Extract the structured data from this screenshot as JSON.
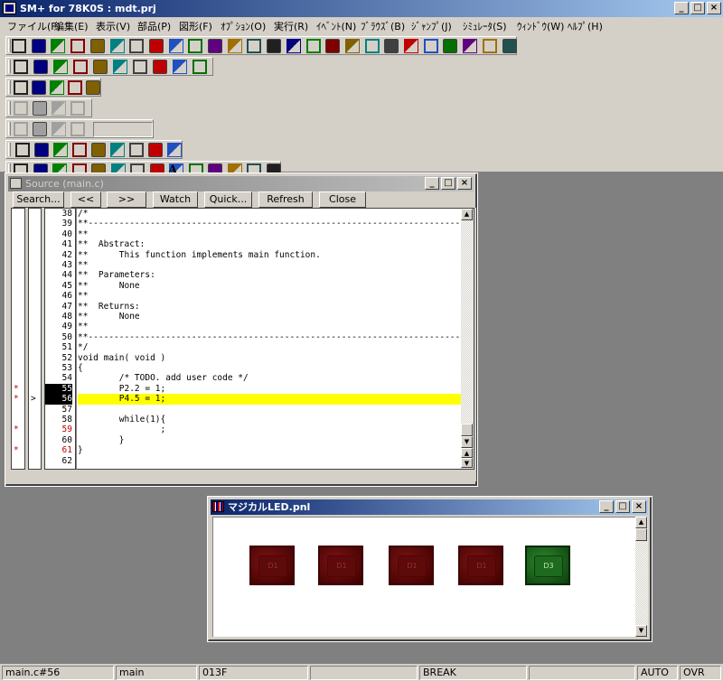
{
  "app": {
    "title": "SM+ for 78K0S : mdt.prj"
  },
  "caption_buttons": {
    "minimize": "_",
    "maximize": "□",
    "close": "×"
  },
  "menu": [
    "ファイル(F)",
    "編集(E)",
    "表示(V)",
    "部品(P)",
    "図形(F)",
    "ｵﾌﾟｼｮﾝ(O)",
    "実行(R)",
    "ｲﾍﾞﾝﾄ(N)",
    "ﾌﾞﾗｳｽﾞ(B)",
    "ｼﾞｬﾝﾌﾟ(J)",
    "ｼﾐｭﾚｰﾀ(S)",
    "ｳｨﾝﾄﾞｳ(W)",
    "ﾍﾙﾌﾟ(H)"
  ],
  "toolbar": {
    "execution": [
      "stop-icon",
      "step-in-icon",
      "run-icon",
      "step-over-icon",
      "return-icon",
      "step-icon",
      "go-icon",
      "eject-icon",
      "source-icon",
      "assemble-icon",
      "memory-icon",
      "register-icon",
      "sfr-icon",
      "watch-icon",
      "search-icon",
      "stack-icon",
      "trace-icon",
      "break-icon",
      "variable-icon",
      "timer-icon",
      "event-icon",
      "panel-icon",
      "flag-icon",
      "break-point-icon",
      "reset-icon",
      "clock-icon"
    ],
    "file": [
      "new-icon",
      "open-icon",
      "save-icon",
      "undo-icon",
      "redo-icon",
      "cut-icon",
      "copy-icon",
      "paste-icon",
      "find-icon",
      "help-icon"
    ],
    "align": [
      "align-icon",
      "grid-icon",
      "monitor-icon",
      "color-icon",
      "spacing-icon"
    ],
    "parts_disabled": [
      "part-a-icon",
      "part-b-icon",
      "part-c-icon",
      "part-d-icon"
    ],
    "edit_disabled": [
      "erase-icon",
      "edit-a-icon",
      "edit-b-icon",
      "edit-c-icon"
    ],
    "combo_value": "",
    "parts": [
      "button-part-icon",
      "grid-part-icon",
      "globe-part-icon",
      "led-part-icon",
      "seg7-part-icon",
      "seg14-part-icon",
      "matrix-part-icon",
      "buzzer-part-icon",
      "level-part-icon"
    ],
    "draw": [
      "pointer-icon",
      "hand-icon",
      "line-icon",
      "rectangle-icon",
      "rounded-rect-icon",
      "ellipse-icon",
      "polygon-icon",
      "free-shape-icon",
      "text-icon",
      "fill-color-icon",
      "line-color-icon",
      "text-color-icon",
      "line-style-icon",
      "pattern-icon"
    ],
    "text_tool_label": "A"
  },
  "source_window": {
    "title": "Source (main.c)",
    "buttons": [
      "Search...",
      "<<",
      ">>",
      "Watch",
      "Quick...",
      "Refresh",
      "Close"
    ],
    "current_line": 56,
    "lines": [
      {
        "n": "38",
        "text": "/*",
        "mark": "",
        "cur": false
      },
      {
        "n": "39",
        "text": "**------------------------------------------------------------------------------------------",
        "mark": "",
        "cur": false
      },
      {
        "n": "40",
        "text": "**",
        "mark": "",
        "cur": false
      },
      {
        "n": "41",
        "text": "**  Abstract:",
        "mark": "",
        "cur": false
      },
      {
        "n": "42",
        "text": "**      This function implements main function.",
        "mark": "",
        "cur": false
      },
      {
        "n": "43",
        "text": "**",
        "mark": "",
        "cur": false
      },
      {
        "n": "44",
        "text": "**  Parameters:",
        "mark": "",
        "cur": false
      },
      {
        "n": "45",
        "text": "**      None",
        "mark": "",
        "cur": false
      },
      {
        "n": "46",
        "text": "**",
        "mark": "",
        "cur": false
      },
      {
        "n": "47",
        "text": "**  Returns:",
        "mark": "",
        "cur": false
      },
      {
        "n": "48",
        "text": "**      None",
        "mark": "",
        "cur": false
      },
      {
        "n": "49",
        "text": "**",
        "mark": "",
        "cur": false
      },
      {
        "n": "50",
        "text": "**------------------------------------------------------------------------------------------",
        "mark": "",
        "cur": false
      },
      {
        "n": "51",
        "text": "*/",
        "mark": "",
        "cur": false
      },
      {
        "n": "52",
        "text": "void main( void )",
        "mark": "",
        "cur": false
      },
      {
        "n": "53",
        "text": "{",
        "mark": "",
        "cur": false
      },
      {
        "n": "54",
        "text": "        /* TODO. add user code */",
        "mark": "",
        "cur": false
      },
      {
        "n": "55",
        "text": "        P2.2 = 1;",
        "mark": "*",
        "cur": false
      },
      {
        "n": "56",
        "text": "        P4.5 = 1;",
        "mark": "*",
        "cur": true
      },
      {
        "n": "57",
        "text": "",
        "mark": "",
        "cur": false
      },
      {
        "n": "58",
        "text": "        while(1){",
        "mark": "",
        "cur": false
      },
      {
        "n": "59",
        "text": "                ;",
        "mark": "*",
        "cur": false
      },
      {
        "n": "60",
        "text": "        }",
        "mark": "",
        "cur": false
      },
      {
        "n": "61",
        "text": "}",
        "mark": "*",
        "cur": false
      },
      {
        "n": "62",
        "text": "",
        "mark": "",
        "cur": false
      }
    ],
    "pc_arrow": ">"
  },
  "panel_window": {
    "title": "マジカルLED.pnl",
    "leds": [
      {
        "label": "D1",
        "on": false
      },
      {
        "label": "D1",
        "on": false
      },
      {
        "label": "D1",
        "on": false
      },
      {
        "label": "D1",
        "on": false
      },
      {
        "label": "D3",
        "on": true
      }
    ]
  },
  "statusbar": [
    "main.c#56",
    "main",
    "013F",
    "",
    "BREAK",
    "",
    "AUTO",
    "OVR"
  ],
  "colors": {
    "highlight": "#ffff00",
    "current_line_number_bg": "#000000",
    "breakpoint_mark": "#c00000"
  }
}
